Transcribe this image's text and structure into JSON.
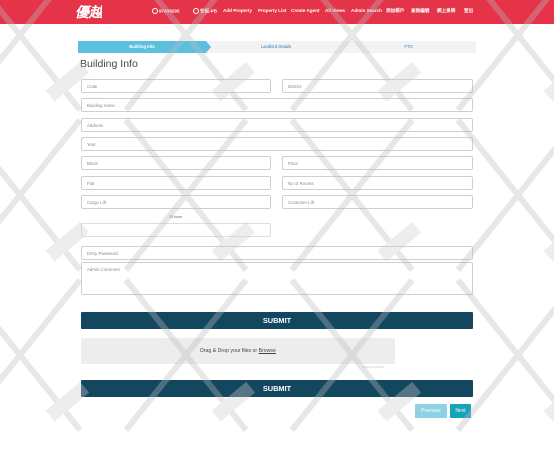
{
  "navbar": {
    "logo_text": "優越",
    "items": [
      {
        "label": "97838295",
        "whatsapp": true
      },
      {
        "label": "安板-PB",
        "whatsapp": true
      },
      {
        "label": "Add Property"
      },
      {
        "label": "Property List"
      },
      {
        "label": "Create Agent"
      },
      {
        "label": "All Views"
      },
      {
        "label": "Admin Search"
      },
      {
        "label": "添加帳戶"
      },
      {
        "label": "查詢編號"
      },
      {
        "label": "網上掛牌"
      },
      {
        "label": "登出"
      }
    ]
  },
  "steps": [
    {
      "label": "Building Info",
      "active": true
    },
    {
      "label": "Landlord Details",
      "active": false
    },
    {
      "label": "FTO",
      "active": false
    }
  ],
  "form": {
    "title": "Building Info",
    "code_placeholder": "Code",
    "district_placeholder": "District",
    "building_name_placeholder": "Building name",
    "address_placeholder": "Address",
    "year_placeholder": "Year",
    "block_placeholder": "Block",
    "floor_placeholder": "Floor",
    "flat_placeholder": "Flat",
    "no_of_rooms_placeholder": "No of Rooms",
    "cargo_lift_placeholder": "Cargo Lift",
    "customer_lift_placeholder": "Customer Lift",
    "hours_label": "24 hour",
    "entry_password_placeholder": "Entry Password",
    "admin_comment_placeholder": "Admin Comment",
    "submit_label": "SUBMIT"
  },
  "upload": {
    "text": "Drag & Drop your files or ",
    "browse": "Browse",
    "powered": "Powered by PQINA",
    "submit_label": "SUBMIT"
  },
  "pager": {
    "previous": "Previous",
    "next": "Next"
  },
  "colors": {
    "navbar": "#e5344a",
    "active_step": "#5bc0de",
    "submit": "#13465f",
    "next": "#17a2b8",
    "previous": "#8fd1e4"
  }
}
